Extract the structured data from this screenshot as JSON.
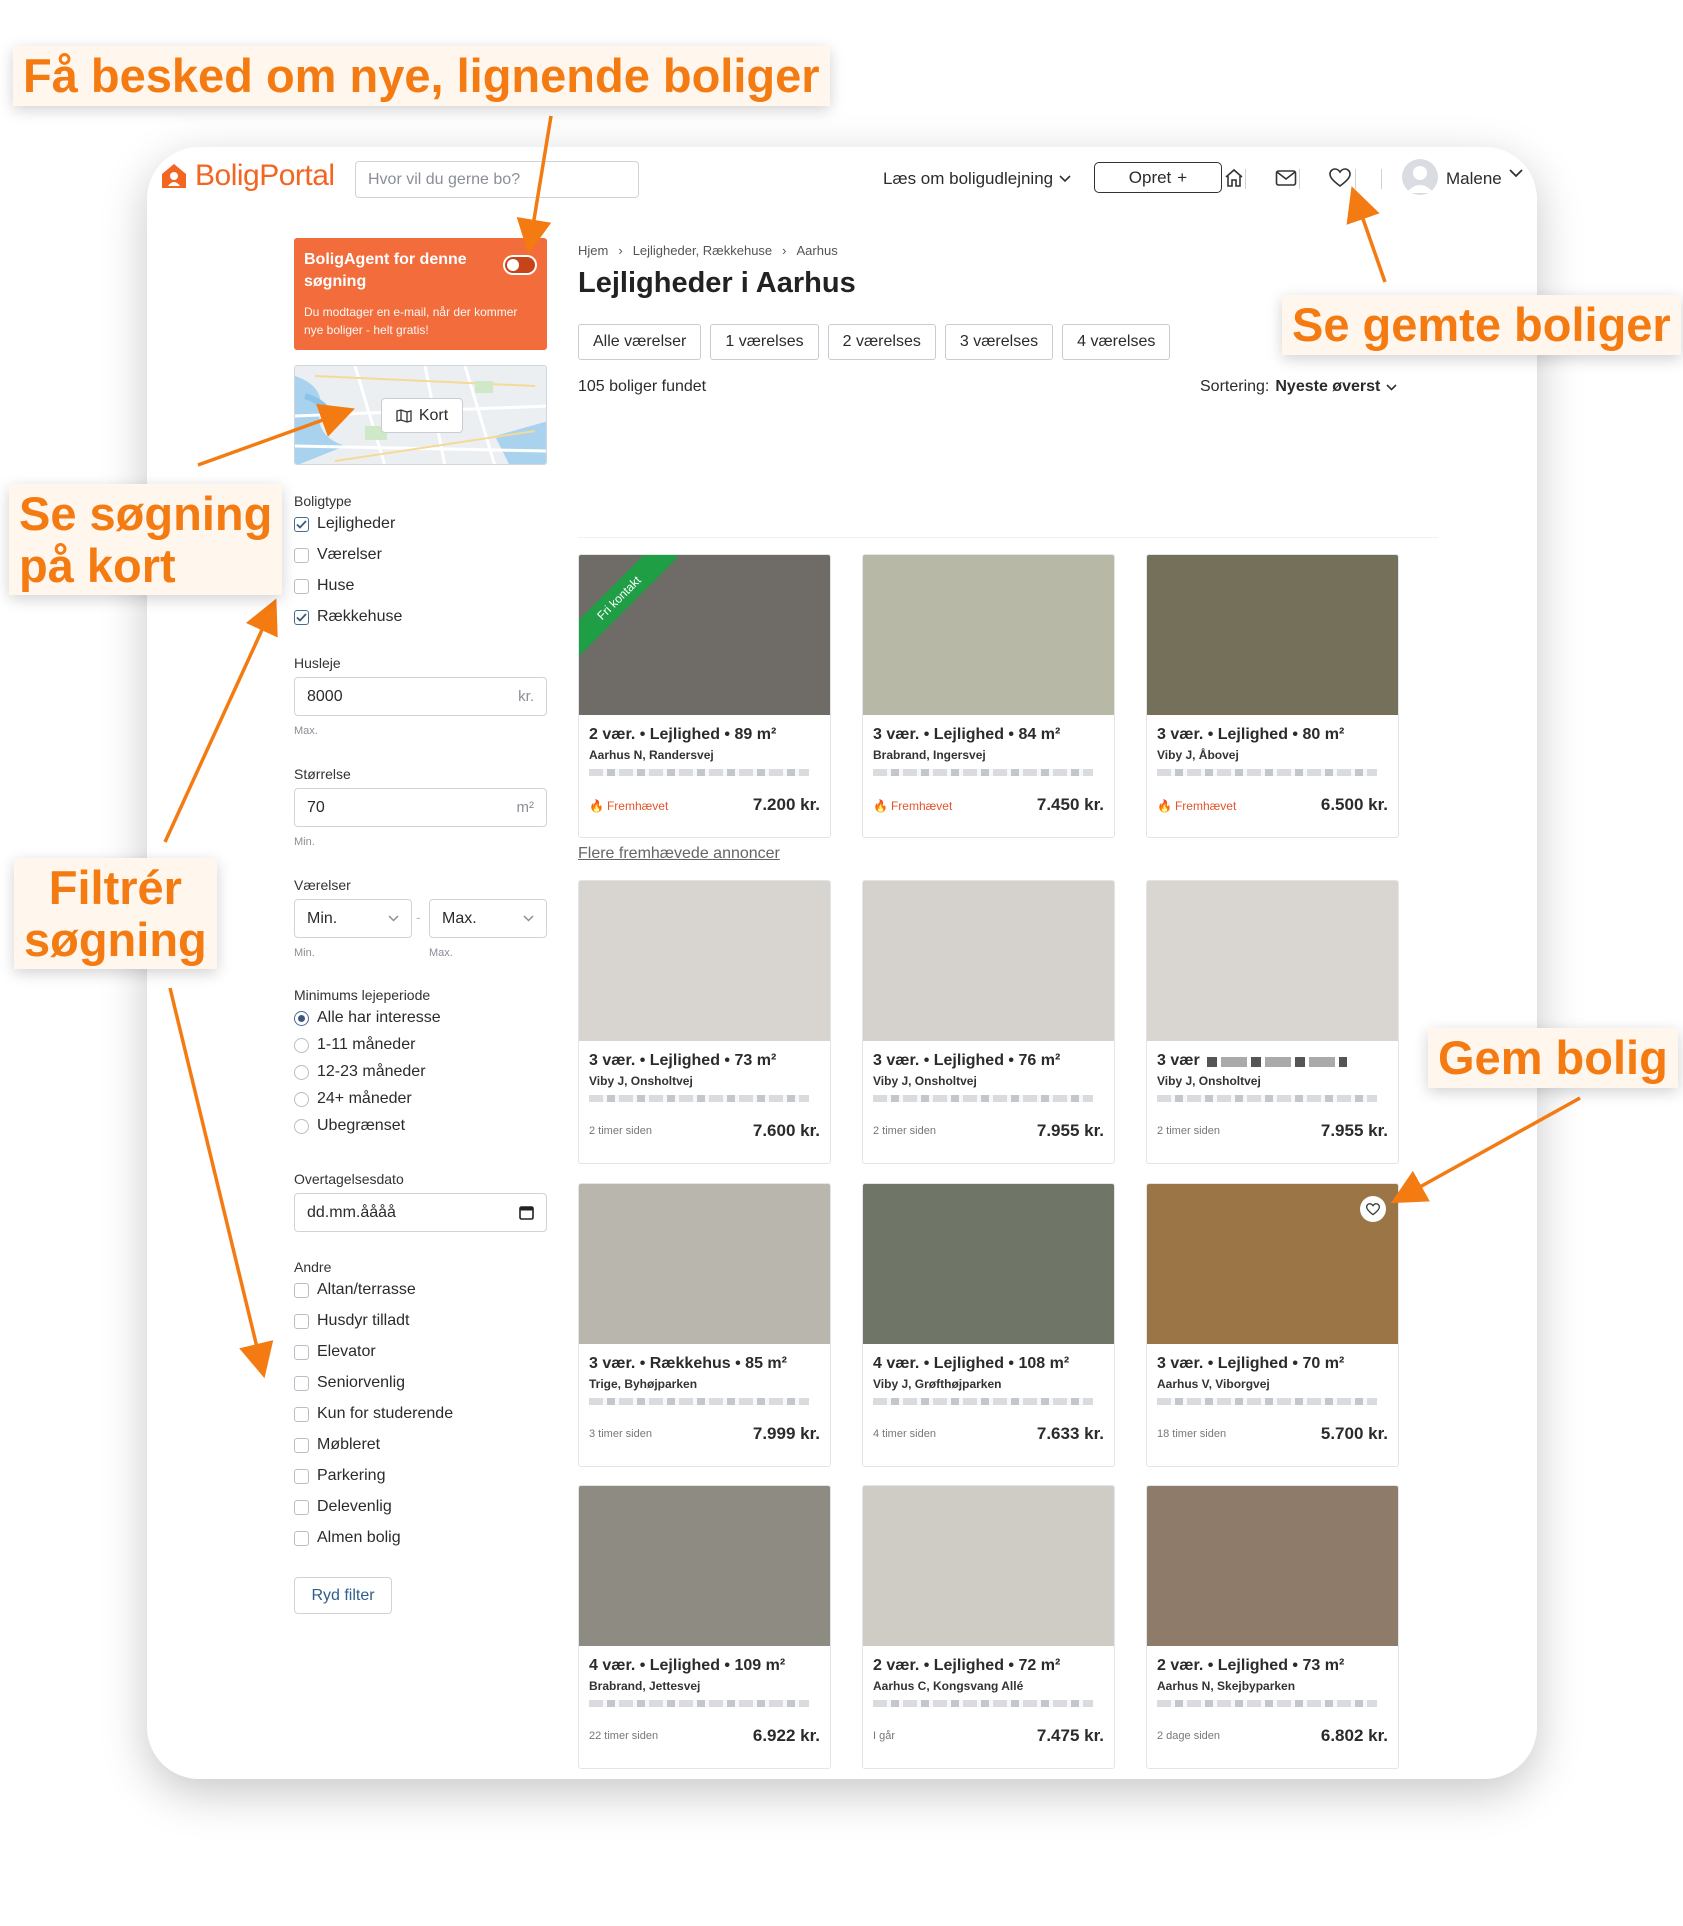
{
  "annotations": {
    "alerts": "Få besked om nye, lignende boliger",
    "saved": "Se gemte boliger",
    "map_line1": "Se søgning",
    "map_line2": "på kort",
    "filter_line1": "Filtrér",
    "filter_line2": "søgning",
    "save": "Gem bolig"
  },
  "header": {
    "logo_text": "BoligPortal",
    "search_placeholder": "Hvor vil du gerne bo?",
    "learn_label": "Læs om boligudlejning",
    "create_label": "Opret",
    "user_name": "Malene"
  },
  "sidebar": {
    "agent_title": "BoligAgent for denne søgning",
    "agent_desc": "Du modtager en e-mail, når der kommer nye boliger - helt gratis!",
    "map_label": "Kort",
    "property_type_label": "Boligtype",
    "property_types": [
      "Lejligheder",
      "Værelser",
      "Huse",
      "Rækkehuse"
    ],
    "rent_label": "Husleje",
    "rent_value": "8000",
    "rent_unit": "kr.",
    "rent_hint": "Max.",
    "size_label": "Størrelse",
    "size_value": "70",
    "size_unit": "m²",
    "size_hint": "Min.",
    "rooms_label": "Værelser",
    "rooms_min": "Min.",
    "rooms_max": "Max.",
    "rooms_min_hint": "Min.",
    "rooms_max_hint": "Max.",
    "period_label": "Minimums lejeperiode",
    "periods": [
      "Alle har interesse",
      "1-11 måneder",
      "12-23 måneder",
      "24+ måneder",
      "Ubegrænset"
    ],
    "date_label": "Overtagelsesdato",
    "date_placeholder": "dd.mm.åååå",
    "other_label": "Andre",
    "others": [
      "Altan/terrasse",
      "Husdyr tilladt",
      "Elevator",
      "Seniorvenlig",
      "Kun for studerende",
      "Møbleret",
      "Parkering",
      "Delevenlig",
      "Almen bolig"
    ],
    "clear_label": "Ryd filter"
  },
  "main": {
    "breadcrumbs": [
      "Hjem",
      "Lejligheder, Rækkehuse",
      "Aarhus"
    ],
    "title": "Lejligheder i Aarhus",
    "room_chips": [
      "Alle værelser",
      "1 værelses",
      "2 værelses",
      "3 værelses",
      "4 værelses"
    ],
    "count": "105 boliger fundet",
    "sort_label": "Sortering:",
    "sort_value": "Nyeste øverst",
    "featured_label": "Fremhævet",
    "more_featured": "Flere fremhævede annoncer",
    "ribbon": "Fri kontakt",
    "featured": [
      {
        "title": "2 vær. • Lejlighed • 89 m²",
        "location": "Aarhus N, Randersvej",
        "price": "7.200 kr.",
        "color": "#6f6c68"
      },
      {
        "title": "3 vær. • Lejlighed • 84 m²",
        "location": "Brabrand, Ingersvej",
        "price": "7.450 kr.",
        "color": "#b7b9a6"
      },
      {
        "title": "3 vær. • Lejlighed • 80 m²",
        "location": "Viby J, Åbovej",
        "price": "6.500 kr.",
        "color": "#75705a"
      }
    ],
    "listings": [
      {
        "title": "3 vær. • Lejlighed • 73 m²",
        "location": "Viby J, Onsholtvej",
        "time": "2 timer siden",
        "price": "7.600 kr.",
        "color": "#d8d4cf"
      },
      {
        "title": "3 vær. • Lejlighed • 76 m²",
        "location": "Viby J, Onsholtvej",
        "time": "2 timer siden",
        "price": "7.955 kr.",
        "color": "#d5d1cc"
      },
      {
        "title": "3 vær",
        "location": "Viby J, Onsholtvej",
        "time": "2 timer siden",
        "price": "7.955 kr.",
        "color": "#d9d5d0"
      },
      {
        "title": "3 vær. • Rækkehus • 85 m²",
        "location": "Trige, Byhøjparken",
        "time": "3 timer siden",
        "price": "7.999 kr.",
        "color": "#b8b6ad"
      },
      {
        "title": "4 vær. • Lejlighed • 108 m²",
        "location": "Viby J, Grøfthøjparken",
        "time": "4 timer siden",
        "price": "7.633 kr.",
        "color": "#6f7668"
      },
      {
        "title": "3 vær. • Lejlighed • 70 m²",
        "location": "Aarhus V, Viborgvej",
        "time": "18 timer siden",
        "price": "5.700 kr.",
        "color": "#9b7546"
      },
      {
        "title": "4 vær. • Lejlighed • 109 m²",
        "location": "Brabrand, Jettesvej",
        "time": "22 timer siden",
        "price": "6.922 kr.",
        "color": "#8e8b82"
      },
      {
        "title": "2 vær. • Lejlighed • 72 m²",
        "location": "Aarhus C, Kongsvang Allé",
        "time": "I går",
        "price": "7.475 kr.",
        "color": "#cfccc6"
      },
      {
        "title": "2 vær. • Lejlighed • 73 m²",
        "location": "Aarhus N, Skejbyparken",
        "time": "2 dage siden",
        "price": "6.802 kr.",
        "color": "#8f7b6a"
      }
    ]
  },
  "colors": {
    "brand": "#f26522",
    "annotation": "#f47b12",
    "agent": "#f26c3c"
  }
}
